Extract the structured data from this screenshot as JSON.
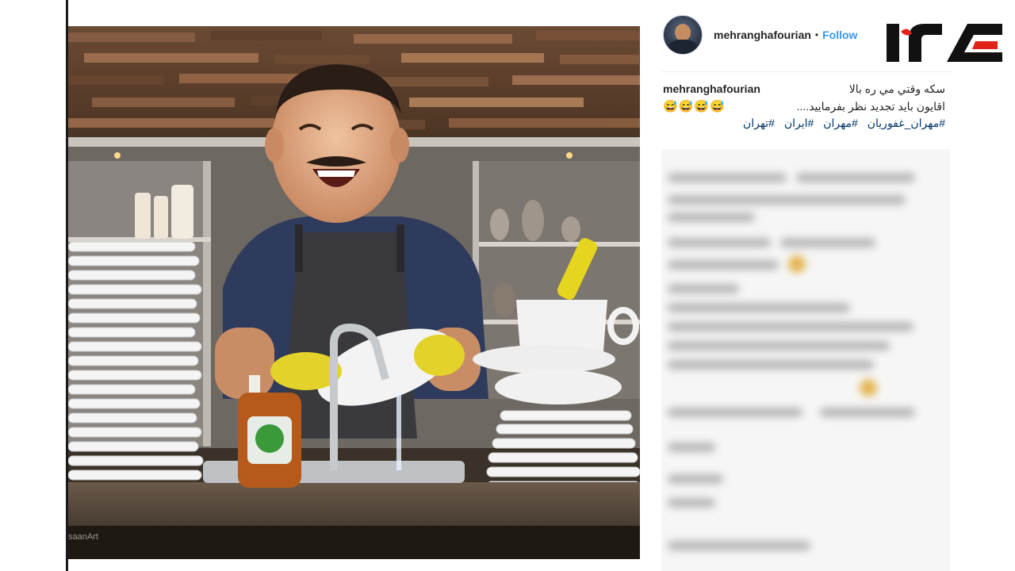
{
  "post": {
    "username": "mehranghafourian",
    "separator": "•",
    "follow_label": "Follow"
  },
  "caption": {
    "username": "mehranghafourian",
    "line1": "سکه وقتي مي ره بالا",
    "line2": "اقايون بايد تجديد نظر بفرماييد....",
    "emojis": "😅😅😅😅",
    "hashtags": [
      "#تهران",
      "#ایران",
      "#مهران",
      "#مهران_غفوریان"
    ]
  },
  "photo": {
    "watermark": "saanArt"
  },
  "icons": {
    "avatar": "profile-photo",
    "logo": "site-logo"
  },
  "colors": {
    "follow": "#3897f0",
    "hashtag": "#003569",
    "logo_red": "#e2231a",
    "logo_black": "#111111"
  }
}
